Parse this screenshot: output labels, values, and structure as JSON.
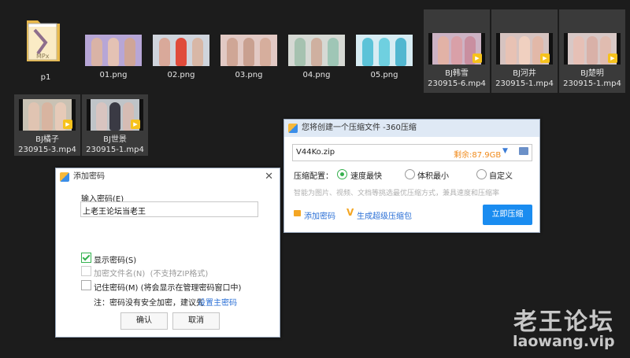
{
  "files": [
    {
      "name": "p1"
    },
    {
      "name": "01.png"
    },
    {
      "name": "02.png"
    },
    {
      "name": "03.png"
    },
    {
      "name": "04.png"
    },
    {
      "name": "05.png"
    },
    {
      "line1": "BJ韩雪",
      "line2": "230915-6.mp4"
    },
    {
      "line1": "BJ河井",
      "line2": "230915-1.mp4"
    },
    {
      "line1": "BJ楚明",
      "line2": "230915-1.mp4"
    },
    {
      "line1": "BJ橘子",
      "line2": "230915-3.mp4"
    },
    {
      "line1": "BJ世景",
      "line2": "230915-1.mp4"
    }
  ],
  "video_badge": "Player",
  "compress_dialog": {
    "title": "您将创建一个压缩文件 -360压缩",
    "filename": "V44Ko.zip",
    "space": "剩余:87.9GB",
    "config_label": "压缩配置：",
    "options": [
      "速度最快",
      "体积最小",
      "自定义"
    ],
    "hint": "智能为图片、视频、文档等挑选最优压缩方式，兼具速度和压缩率",
    "add_password": "添加密码",
    "super_package": "生成超级压缩包",
    "compress_now": "立即压缩"
  },
  "password_dialog": {
    "title": "添加密码",
    "input_label": "输入密码(E)",
    "password_value": "上老王论坛当老王",
    "show_password": "显示密码(S)",
    "encrypt_filename": "加密文件名(N)  (不支持ZIP格式)",
    "remember_password": "记住密码(M) (将会显示在管理密码窗口中)",
    "note": "注：密码没有安全加密，建议先",
    "note_link": "设置主密码",
    "ok": "确认",
    "cancel": "取消"
  },
  "watermark": {
    "title": "老王论坛",
    "url": "laowang.vip"
  }
}
